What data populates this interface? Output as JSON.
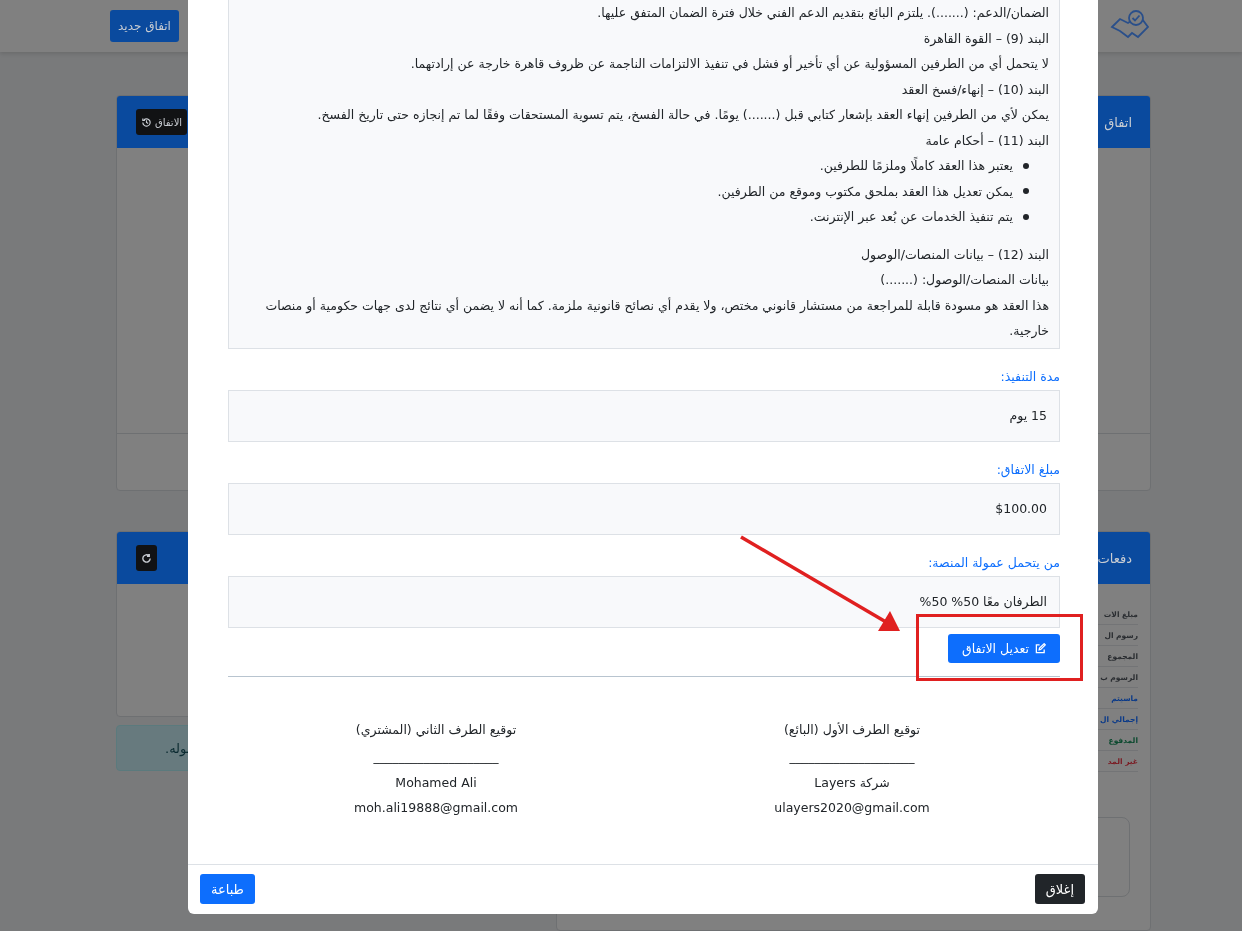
{
  "header": {
    "new_agreement_button": "اتفاق جديد"
  },
  "background": {
    "agreement_card": {
      "title": "اتفاق",
      "history_button": "الاتفاق"
    },
    "payments_card": {
      "title": "دفعات",
      "rows": [
        {
          "text": "مبلغ الات",
          "color": "#2a2d31"
        },
        {
          "text": "رسوم ال",
          "color": "#2a2d31"
        },
        {
          "text": "المجموع",
          "color": "#2a2d31"
        },
        {
          "text": "الرسوم ب",
          "color": "#2a2d31"
        },
        {
          "text": "ماسيتم",
          "color": "#0b3a88"
        },
        {
          "text": "إجمالي ال",
          "color": "#0b3a88"
        },
        {
          "text": "المدفوع",
          "color": "#0c4a2f"
        },
        {
          "text": "غير المد",
          "color": "#7a1a22"
        }
      ]
    },
    "alert": "بوله."
  },
  "modal": {
    "contract": [
      {
        "kind": "paragraph",
        "text": "الضمان/الدعم: (.......). يلتزم البائع بتقديم الدعم الفني خلال فترة الضمان المتفق عليها."
      },
      {
        "kind": "paragraph",
        "text": "البند (9) – القوة القاهرة"
      },
      {
        "kind": "paragraph",
        "text": "لا يتحمل أي من الطرفين المسؤولية عن أي تأخير أو فشل في تنفيذ الالتزامات الناجمة عن ظروف قاهرة خارجة عن إرادتهما."
      },
      {
        "kind": "paragraph",
        "text": "البند (10) – إنهاء/فسخ العقد"
      },
      {
        "kind": "paragraph",
        "text": "يمكن لأي من الطرفين إنهاء العقد بإشعار كتابي قبل (.......) يومًا. في حالة الفسخ، يتم تسوية المستحقات وفقًا لما تم إنجازه حتى تاريخ الفسخ."
      },
      {
        "kind": "paragraph",
        "text": "البند (11) – أحكام عامة"
      },
      {
        "kind": "list",
        "items": [
          "يعتبر هذا العقد كاملًا وملزمًا للطرفين.",
          "يمكن تعديل هذا العقد بملحق مكتوب وموقع من الطرفين.",
          "يتم تنفيذ الخدمات عن بُعد عبر الإنترنت."
        ]
      },
      {
        "kind": "paragraph",
        "text": "البند (12) – بيانات المنصات/الوصول"
      },
      {
        "kind": "paragraph",
        "text": "بيانات المنصات/الوصول: (.......)"
      },
      {
        "kind": "paragraph",
        "text": "هذا العقد هو مسودة قابلة للمراجعة من مستشار قانوني مختص، ولا يقدم أي نصائح قانونية ملزمة. كما أنه لا يضمن أي نتائج لدى جهات حكومية أو منصات خارجية."
      }
    ],
    "fields": [
      {
        "label": "مدة التنفيذ:",
        "value": "15 يوم"
      },
      {
        "label": "مبلغ الاتفاق:",
        "value": "$100.00"
      },
      {
        "label": "من يتحمل عمولة المنصة:",
        "value": "الطرفان معًا 50% 50%"
      }
    ],
    "edit_button": "تعديل الاتفاق",
    "signatures": [
      {
        "title": "توقيع الطرف الأول (البائع)",
        "line": "____________________",
        "name": "شركة Layers",
        "email": "ulayers2020@gmail.com"
      },
      {
        "title": "توقيع الطرف الثاني (المشتري)",
        "line": "____________________",
        "name": "Mohamed Ali",
        "email": "moh.ali19888@gmail.com"
      }
    ],
    "close_button": "إغلاق",
    "print_button": "طباعة"
  }
}
